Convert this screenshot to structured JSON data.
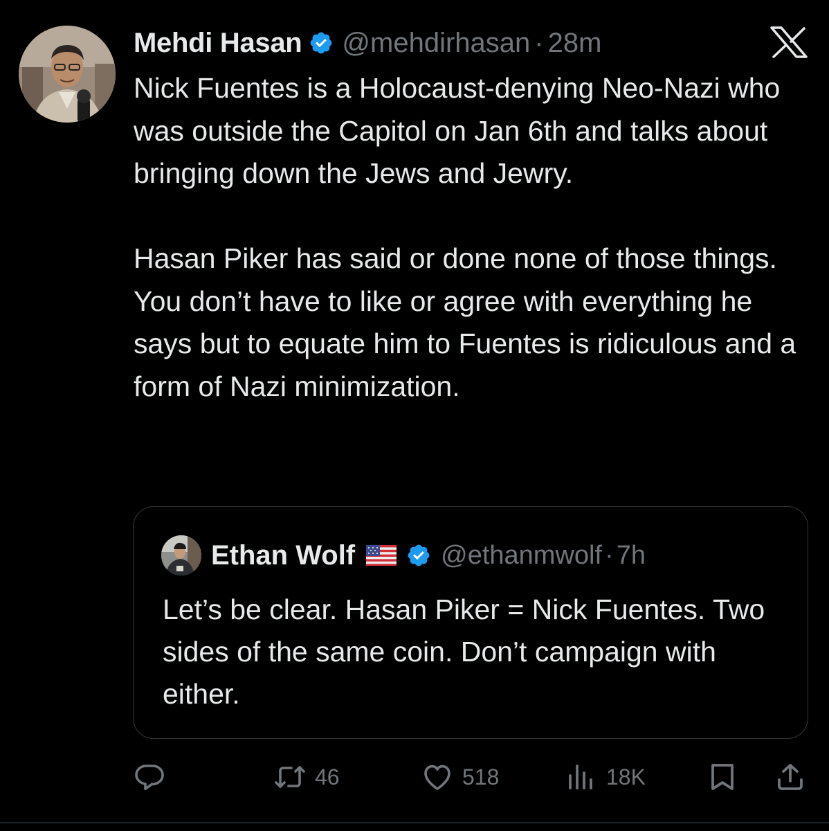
{
  "tweet": {
    "author_name": "Mehdi Hasan",
    "author_handle": "@mehdirhasan",
    "separator": "·",
    "time": "28m",
    "paragraphs": [
      "Nick Fuentes is a Holocaust-denying Neo-Nazi who was outside the Capitol on Jan 6th and talks about bringing down the Jews and Jewry.",
      "Hasan Piker has said or done none of those things. You don’t have to like or agree with everything he says but to equate him to Fuentes is ridiculous and a form of Nazi minimization."
    ]
  },
  "quote": {
    "author_name": "Ethan Wolf",
    "author_handle": "@ethanmwolf",
    "separator": "·",
    "time": "7h",
    "text": "Let’s be clear. Hasan Piker = Nick Fuentes. Two sides of the same coin. Don’t campaign with either."
  },
  "actions": {
    "reposts": "46",
    "likes": "518",
    "views": "18K"
  },
  "icons": {
    "close": "x-logo-icon",
    "reply": "reply-icon",
    "repost": "repost-icon",
    "like": "heart-icon",
    "views": "views-icon",
    "bookmark": "bookmark-icon",
    "share": "share-icon"
  },
  "colors": {
    "background": "#000000",
    "text": "#e7e9ea",
    "secondary": "#71767b",
    "verified": "#1d9bf0",
    "border": "#333639"
  }
}
